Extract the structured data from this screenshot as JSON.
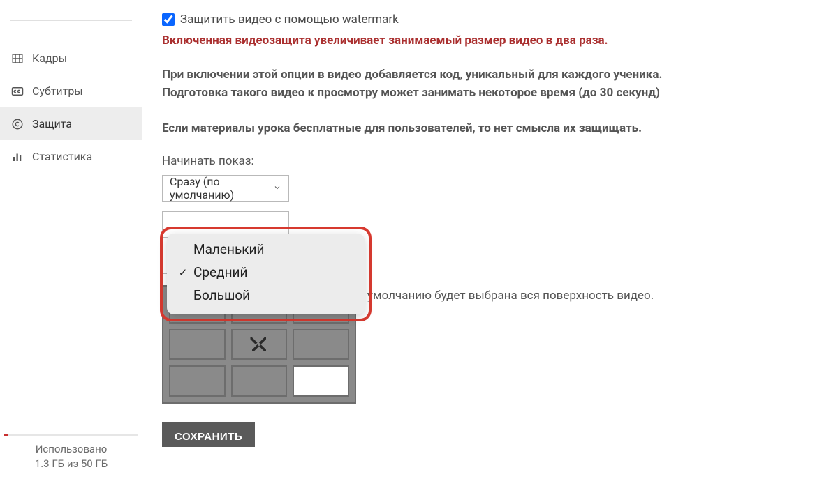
{
  "sidebar": {
    "items": [
      {
        "label": "Кадры",
        "icon": "film"
      },
      {
        "label": "Субтитры",
        "icon": "cc"
      },
      {
        "label": "Защита",
        "icon": "copyright"
      },
      {
        "label": "Статистика",
        "icon": "bars"
      }
    ],
    "storage": {
      "used_label": "Использовано",
      "used_value": "1.3 ГБ из 50 ГБ"
    }
  },
  "main": {
    "checkbox_label": "Защитить видео с помощью watermark",
    "warning": "Включенная видеозащита увеличивает занимаемый размер видео в два раза.",
    "info_line1": "При включении этой опции в видео добавляется код, уникальный для каждого ученика.",
    "info_line2": "Подготовка такого видео к просмотру может занимать некоторое время (до 30 секунд)",
    "info_line3": "Если материалы урока бесплатные для пользователей, то нет смысла их защищать.",
    "start_label": "Начинать показ:",
    "start_selected": "Сразу (по умолчанию)",
    "size_options": [
      "Маленький",
      "Средний",
      "Большой"
    ],
    "size_selected": "Средний",
    "region_hint_tail": "о умолчанию будет выбрана вся поверхность видео.",
    "save_label": "СОХРАНИТЬ"
  }
}
